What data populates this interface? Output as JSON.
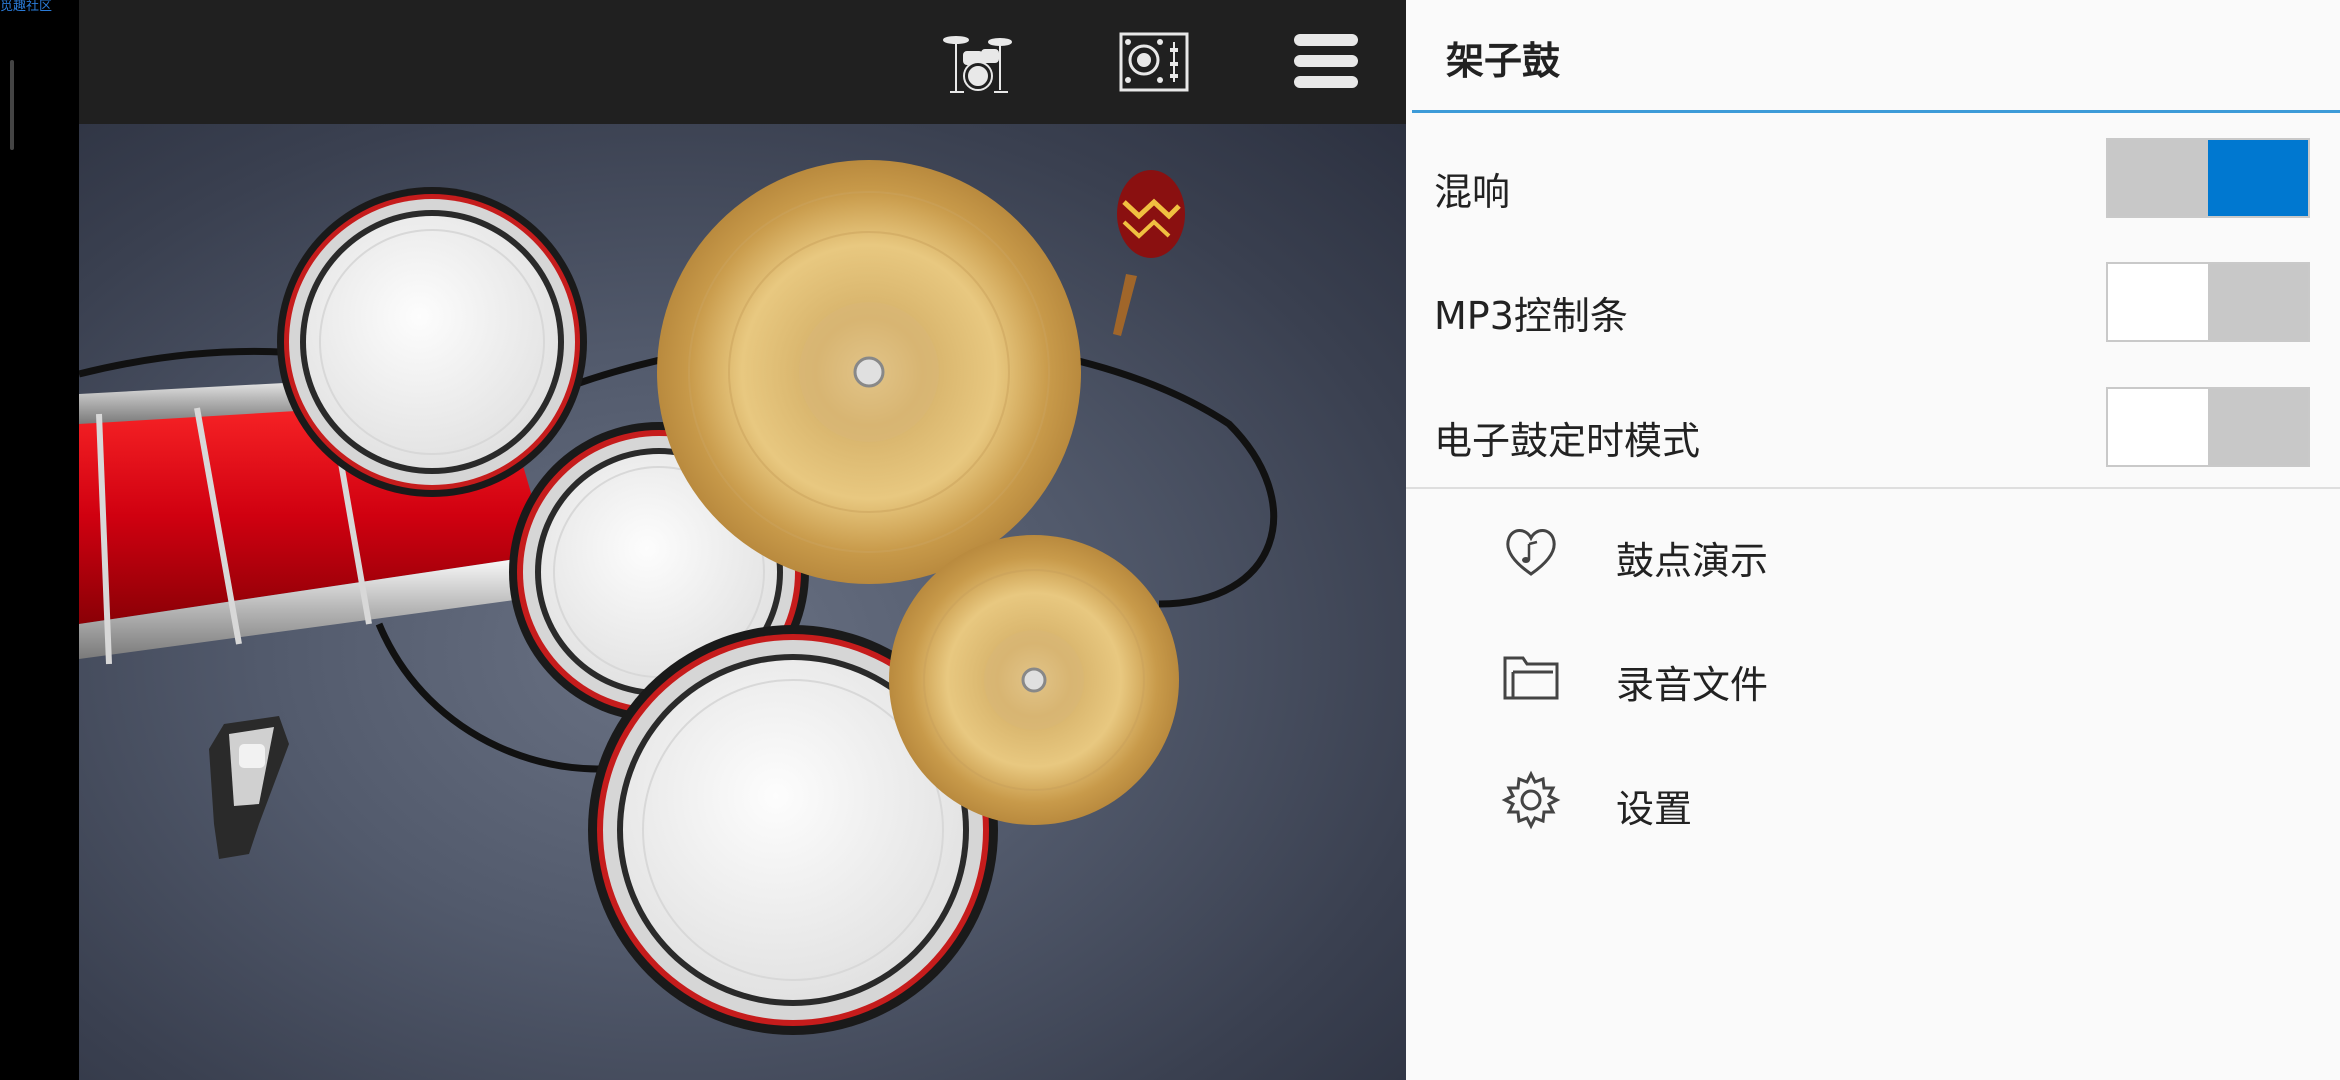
{
  "corner_label": "觅趣社区",
  "app": {
    "colors": {
      "toggle_on": "#0078d0",
      "toggle_off": "#c8c8c8",
      "accent_line": "#3d9bd8"
    },
    "toolbar": {
      "icons": [
        "drum-kit-icon",
        "mixer-icon",
        "menu-icon"
      ]
    }
  },
  "panel": {
    "title": "架子鼓",
    "settings": [
      {
        "label": "混响",
        "on": true
      },
      {
        "label": "MP3控制条",
        "on": false
      },
      {
        "label": "电子鼓定时模式",
        "on": false
      }
    ],
    "menu": [
      {
        "label": "鼓点演示",
        "icon": "heart-music-icon"
      },
      {
        "label": "录音文件",
        "icon": "folder-icon"
      },
      {
        "label": "设置",
        "icon": "gear-icon"
      }
    ]
  }
}
